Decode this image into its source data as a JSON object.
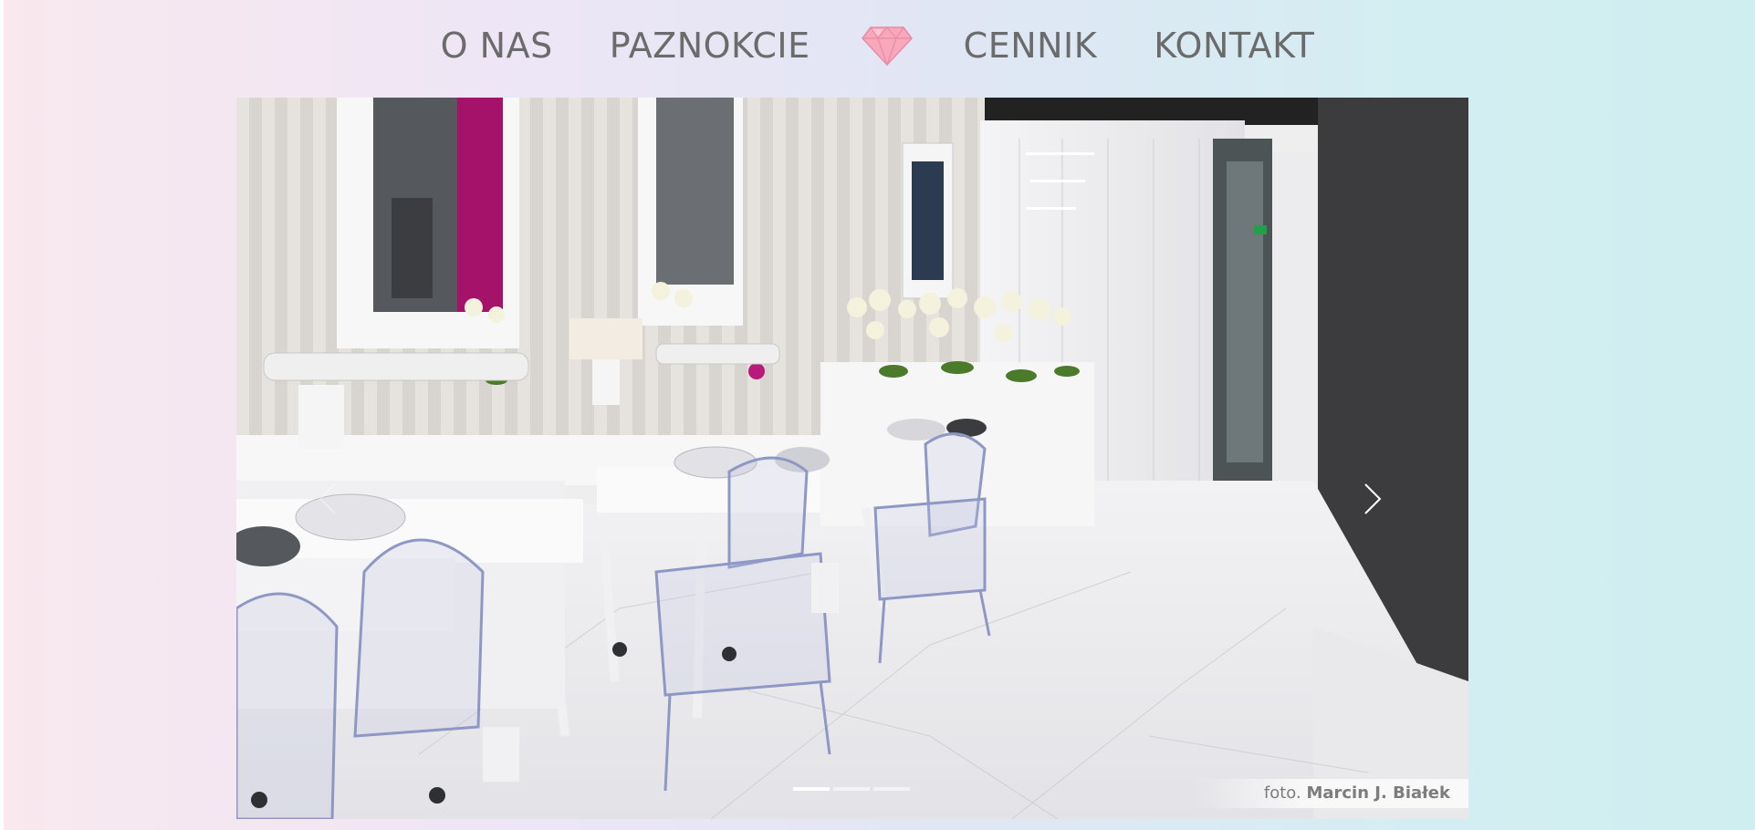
{
  "nav": {
    "items": [
      {
        "label": "O NAS"
      },
      {
        "label": "PAZNOKCIE"
      },
      {
        "label": "CENNIK"
      },
      {
        "label": "KONTAKT"
      }
    ],
    "logo_icon": "diamond-icon",
    "text_color": "#6b6b6b",
    "logo_color": "#f28ca6"
  },
  "slider": {
    "credit_prefix": "foto.",
    "credit_name": "Marcin J. Białek",
    "slide_count": 3,
    "active_slide": 1,
    "prev_icon": "chevron-left-icon",
    "next_icon": "chevron-right-icon"
  }
}
